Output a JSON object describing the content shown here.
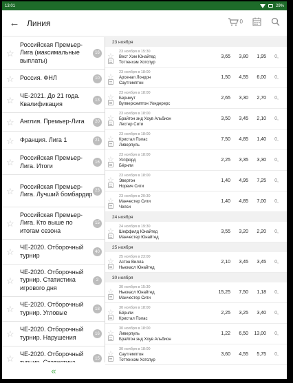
{
  "statusbar": {
    "time": "13:01",
    "battery": "29%"
  },
  "appbar": {
    "title": "Линия",
    "cart_count": "0"
  },
  "sidebar": {
    "items": [
      {
        "label": "Российская Премьер-Лига (максимальные выплаты)",
        "count": "16",
        "lines": 3
      },
      {
        "label": "Россия. ФНЛ",
        "count": "10",
        "lines": 1
      },
      {
        "label": "ЧЕ-2021. До 21 года. Квалификация",
        "count": "13",
        "lines": 2
      },
      {
        "label": "Англия. Премьер-Лига",
        "count": "20",
        "lines": 1
      },
      {
        "label": "Франция. Лига 1",
        "count": "21",
        "lines": 1
      },
      {
        "label": "Российская Премьер-Лига. Итоги",
        "count": "16",
        "lines": 2
      },
      {
        "label": "Российская Премьер-Лига. Лучший бомбардир",
        "count": "23",
        "lines": 3
      },
      {
        "label": "Российская Премьер-Лига. Кто выше по итогам сезона",
        "count": "15",
        "lines": 3
      },
      {
        "label": "ЧЕ-2020. Отборочный турнир",
        "count": "40",
        "lines": 2
      },
      {
        "label": "ЧЕ-2020. Отборочный турнир. Статистика игрового дня",
        "count": "2",
        "lines": 3
      },
      {
        "label": "ЧЕ-2020. Отборочный турнир. Угловые",
        "count": "18",
        "lines": 2
      },
      {
        "label": "ЧЕ-2020. Отборочный турнир. Нарушения",
        "count": "16",
        "lines": 2
      },
      {
        "label": "ЧЕ-2020. Отборочный турнир. Статистика",
        "count": "15",
        "lines": 2
      }
    ],
    "collapse_glyph": "«"
  },
  "matches": [
    {
      "type": "date",
      "label": "23 ноября"
    },
    {
      "type": "match",
      "time": "23 ноября в 15:30",
      "home": "Вест Хэм Юнайтед",
      "away": "Тоттенхэм Хотспур",
      "o1": "3,65",
      "x": "3,80",
      "o2": "1,95",
      "more": "0,"
    },
    {
      "type": "match",
      "time": "23 ноября в 18:00",
      "home": "Арсенал Лондон",
      "away": "Саутгемптон",
      "o1": "1,50",
      "x": "4,55",
      "o2": "6,00",
      "more": "0,"
    },
    {
      "type": "match",
      "time": "23 ноября в 18:00",
      "home": "Бернмут",
      "away": "Вулверхэмптон Уондерерс",
      "o1": "2,65",
      "x": "3,30",
      "o2": "2,70",
      "more": "0,"
    },
    {
      "type": "match",
      "time": "23 ноября в 18:00",
      "home": "Брайтон энд Хоув Альбион",
      "away": "Лестер Сити",
      "o1": "3,50",
      "x": "3,45",
      "o2": "2,10",
      "more": "0,"
    },
    {
      "type": "match",
      "time": "23 ноября в 18:00",
      "home": "Кристал Пэлас",
      "away": "Ливерпуль",
      "o1": "7,50",
      "x": "4,85",
      "o2": "1,40",
      "more": "0,"
    },
    {
      "type": "match",
      "time": "23 ноября в 18:00",
      "home": "Уотфорд",
      "away": "Бёрнли",
      "o1": "2,25",
      "x": "3,35",
      "o2": "3,30",
      "more": "0,"
    },
    {
      "type": "match",
      "time": "23 ноября в 18:00",
      "home": "Эвертон",
      "away": "Норвич Сити",
      "o1": "1,40",
      "x": "4,95",
      "o2": "7,25",
      "more": "0,"
    },
    {
      "type": "match",
      "time": "23 ноября в 20:30",
      "home": "Манчестер Сити",
      "away": "Челси",
      "o1": "1,40",
      "x": "4,85",
      "o2": "7,00",
      "more": "0,"
    },
    {
      "type": "date",
      "label": "24 ноября"
    },
    {
      "type": "match",
      "time": "24 ноября в 19:30",
      "home": "Шеффилд Юнайтед",
      "away": "Манчестер Юнайтед",
      "o1": "3,55",
      "x": "3,20",
      "o2": "2,20",
      "more": "0,"
    },
    {
      "type": "date",
      "label": "25 ноября"
    },
    {
      "type": "match",
      "time": "25 ноября в 23:00",
      "home": "Астон Вилла",
      "away": "Ньюкасл Юнайтед",
      "o1": "2,10",
      "x": "3,45",
      "o2": "3,45",
      "more": "0,"
    },
    {
      "type": "date",
      "label": "30 ноября"
    },
    {
      "type": "match",
      "time": "30 ноября в 15:30",
      "home": "Ньюкасл Юнайтед",
      "away": "Манчестер Сити",
      "o1": "15,25",
      "x": "7,50",
      "o2": "1,18",
      "more": "0,"
    },
    {
      "type": "match",
      "time": "30 ноября в 18:00",
      "home": "Бёрнли",
      "away": "Кристал Пэлас",
      "o1": "2,25",
      "x": "3,25",
      "o2": "3,40",
      "more": "0,"
    },
    {
      "type": "match",
      "time": "30 ноября в 18:00",
      "home": "Ливерпуль",
      "away": "Брайтон энд Хоув Альбион",
      "o1": "1,22",
      "x": "6,50",
      "o2": "13,00",
      "more": "0,"
    },
    {
      "type": "match",
      "time": "30 ноября в 18:00",
      "home": "Саутгемптон",
      "away": "Тоттенхэм Хотспур",
      "o1": "3,60",
      "x": "4,55",
      "o2": "5,75",
      "more": "0,"
    }
  ]
}
